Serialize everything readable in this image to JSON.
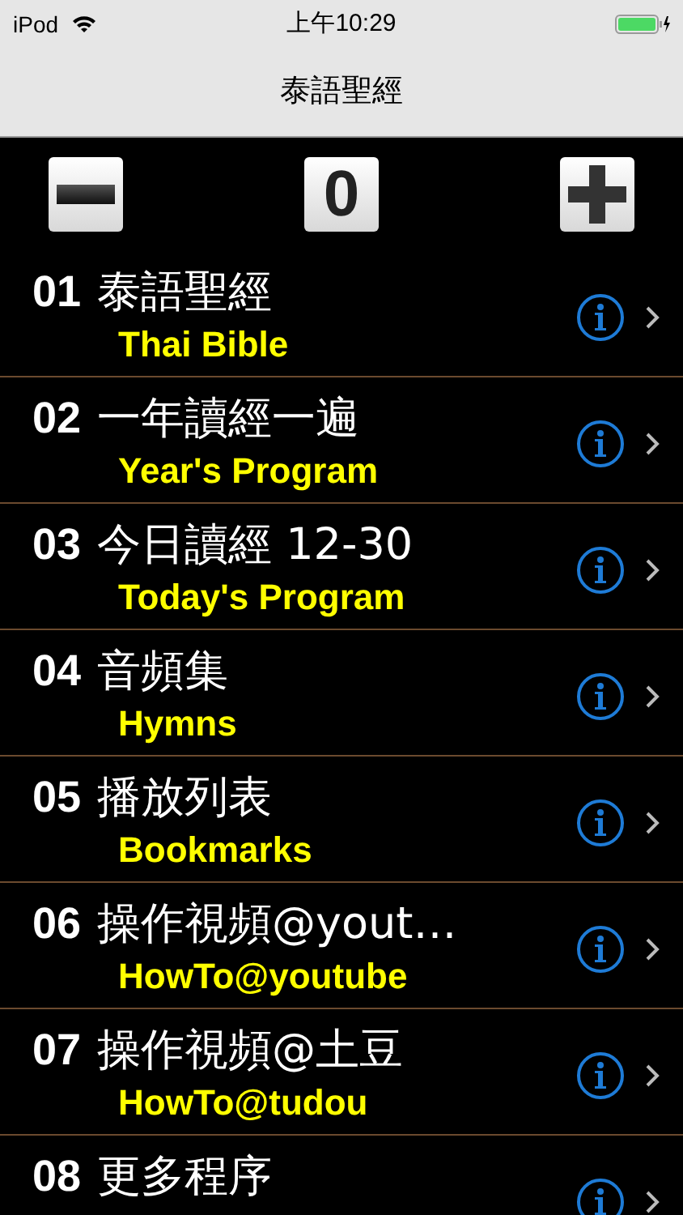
{
  "status_bar": {
    "carrier": "iPod",
    "time": "上午10:29"
  },
  "nav": {
    "title": "泰語聖經"
  },
  "toolbar": {
    "counter": "0"
  },
  "rows": [
    {
      "number": "01",
      "title": "泰語聖經",
      "subtitle": "Thai Bible"
    },
    {
      "number": "02",
      "title": "一年讀經一遍",
      "subtitle": "Year's Program"
    },
    {
      "number": "03",
      "title": "今日讀經 12-30",
      "subtitle": "Today's Program"
    },
    {
      "number": "04",
      "title": "音頻集",
      "subtitle": "Hymns"
    },
    {
      "number": "05",
      "title": "播放列表",
      "subtitle": "Bookmarks"
    },
    {
      "number": "06",
      "title": "操作視頻@yout…",
      "subtitle": "HowTo@youtube"
    },
    {
      "number": "07",
      "title": "操作視頻@土豆",
      "subtitle": "HowTo@tudou"
    },
    {
      "number": "08",
      "title": "更多程序"
    }
  ]
}
